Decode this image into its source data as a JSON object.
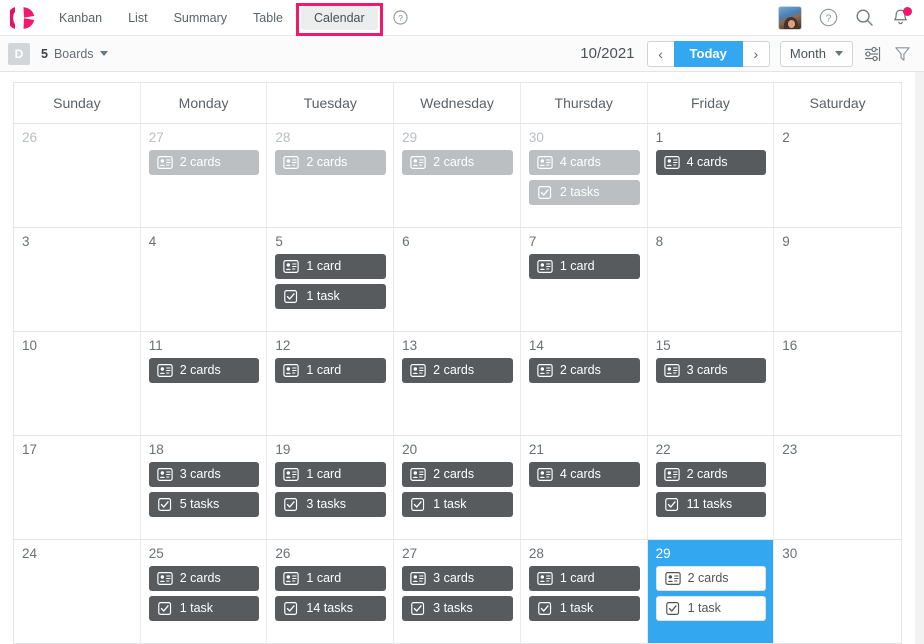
{
  "topnav": {
    "logo_icon": "kanbanize-k-logo",
    "tabs": [
      {
        "label": "Kanban",
        "active": false,
        "name": "tab-kanban"
      },
      {
        "label": "List",
        "active": false,
        "name": "tab-list"
      },
      {
        "label": "Summary",
        "active": false,
        "name": "tab-summary"
      },
      {
        "label": "Table",
        "active": false,
        "name": "tab-table"
      },
      {
        "label": "Calendar",
        "active": true,
        "name": "tab-calendar"
      }
    ],
    "help_icon": "question-circle-icon",
    "avatar_icon": "user-avatar",
    "help_right_icon": "help-circle-icon",
    "search_icon": "search-icon",
    "notification_icon": "bell-icon"
  },
  "toolbar": {
    "board_badge": "D",
    "boards_count": "5",
    "boards_label": "Boards",
    "month_year": "10/2021",
    "prev_label": "‹",
    "today_label": "Today",
    "next_label": "›",
    "view_mode": "Month",
    "settings_icon": "sliders-icon",
    "filter_icon": "filter-funnel-icon"
  },
  "calendar": {
    "accent_blue": "#33a7f0",
    "accent_pink": "#f4176d",
    "badge_dark": "#575b5d",
    "badge_muted": "#bcbfc1",
    "weekdays": [
      "Sunday",
      "Monday",
      "Tuesday",
      "Wednesday",
      "Thursday",
      "Friday",
      "Saturday"
    ],
    "weeks": [
      [
        {
          "day": "26",
          "other": true,
          "today": false,
          "badges": []
        },
        {
          "day": "27",
          "other": true,
          "today": false,
          "badges": [
            {
              "icon": "cards-icon",
              "label": "2 cards"
            }
          ]
        },
        {
          "day": "28",
          "other": true,
          "today": false,
          "badges": [
            {
              "icon": "cards-icon",
              "label": "2 cards"
            }
          ]
        },
        {
          "day": "29",
          "other": true,
          "today": false,
          "badges": [
            {
              "icon": "cards-icon",
              "label": "2 cards"
            }
          ]
        },
        {
          "day": "30",
          "other": true,
          "today": false,
          "badges": [
            {
              "icon": "cards-icon",
              "label": "4 cards"
            },
            {
              "icon": "tasks-icon",
              "label": "2 tasks"
            }
          ]
        },
        {
          "day": "1",
          "other": false,
          "today": false,
          "badges": [
            {
              "icon": "cards-icon",
              "label": "4 cards"
            }
          ]
        },
        {
          "day": "2",
          "other": false,
          "today": false,
          "badges": []
        }
      ],
      [
        {
          "day": "3",
          "other": false,
          "today": false,
          "badges": []
        },
        {
          "day": "4",
          "other": false,
          "today": false,
          "badges": []
        },
        {
          "day": "5",
          "other": false,
          "today": false,
          "badges": [
            {
              "icon": "cards-icon",
              "label": "1 card"
            },
            {
              "icon": "tasks-icon",
              "label": "1 task"
            }
          ]
        },
        {
          "day": "6",
          "other": false,
          "today": false,
          "badges": []
        },
        {
          "day": "7",
          "other": false,
          "today": false,
          "badges": [
            {
              "icon": "cards-icon",
              "label": "1 card"
            }
          ]
        },
        {
          "day": "8",
          "other": false,
          "today": false,
          "badges": []
        },
        {
          "day": "9",
          "other": false,
          "today": false,
          "badges": []
        }
      ],
      [
        {
          "day": "10",
          "other": false,
          "today": false,
          "badges": []
        },
        {
          "day": "11",
          "other": false,
          "today": false,
          "badges": [
            {
              "icon": "cards-icon",
              "label": "2 cards"
            }
          ]
        },
        {
          "day": "12",
          "other": false,
          "today": false,
          "badges": [
            {
              "icon": "cards-icon",
              "label": "1 card"
            }
          ]
        },
        {
          "day": "13",
          "other": false,
          "today": false,
          "badges": [
            {
              "icon": "cards-icon",
              "label": "2 cards"
            }
          ]
        },
        {
          "day": "14",
          "other": false,
          "today": false,
          "badges": [
            {
              "icon": "cards-icon",
              "label": "2 cards"
            }
          ]
        },
        {
          "day": "15",
          "other": false,
          "today": false,
          "badges": [
            {
              "icon": "cards-icon",
              "label": "3 cards"
            }
          ]
        },
        {
          "day": "16",
          "other": false,
          "today": false,
          "badges": []
        }
      ],
      [
        {
          "day": "17",
          "other": false,
          "today": false,
          "badges": []
        },
        {
          "day": "18",
          "other": false,
          "today": false,
          "badges": [
            {
              "icon": "cards-icon",
              "label": "3 cards"
            },
            {
              "icon": "tasks-icon",
              "label": "5 tasks"
            }
          ]
        },
        {
          "day": "19",
          "other": false,
          "today": false,
          "badges": [
            {
              "icon": "cards-icon",
              "label": "1 card"
            },
            {
              "icon": "tasks-icon",
              "label": "3 tasks"
            }
          ]
        },
        {
          "day": "20",
          "other": false,
          "today": false,
          "badges": [
            {
              "icon": "cards-icon",
              "label": "2 cards"
            },
            {
              "icon": "tasks-icon",
              "label": "1 task"
            }
          ]
        },
        {
          "day": "21",
          "other": false,
          "today": false,
          "badges": [
            {
              "icon": "cards-icon",
              "label": "4 cards"
            }
          ]
        },
        {
          "day": "22",
          "other": false,
          "today": false,
          "badges": [
            {
              "icon": "cards-icon",
              "label": "2 cards"
            },
            {
              "icon": "tasks-icon",
              "label": "11 tasks"
            }
          ]
        },
        {
          "day": "23",
          "other": false,
          "today": false,
          "badges": []
        }
      ],
      [
        {
          "day": "24",
          "other": false,
          "today": false,
          "badges": []
        },
        {
          "day": "25",
          "other": false,
          "today": false,
          "badges": [
            {
              "icon": "cards-icon",
              "label": "2 cards"
            },
            {
              "icon": "tasks-icon",
              "label": "1 task"
            }
          ]
        },
        {
          "day": "26",
          "other": false,
          "today": false,
          "badges": [
            {
              "icon": "cards-icon",
              "label": "1 card"
            },
            {
              "icon": "tasks-icon",
              "label": "14 tasks"
            }
          ]
        },
        {
          "day": "27",
          "other": false,
          "today": false,
          "badges": [
            {
              "icon": "cards-icon",
              "label": "3 cards"
            },
            {
              "icon": "tasks-icon",
              "label": "3 tasks"
            }
          ]
        },
        {
          "day": "28",
          "other": false,
          "today": false,
          "badges": [
            {
              "icon": "cards-icon",
              "label": "1 card"
            },
            {
              "icon": "tasks-icon",
              "label": "1 task"
            }
          ]
        },
        {
          "day": "29",
          "other": false,
          "today": true,
          "badges": [
            {
              "icon": "cards-icon",
              "label": "2 cards"
            },
            {
              "icon": "tasks-icon",
              "label": "1 task"
            }
          ]
        },
        {
          "day": "30",
          "other": false,
          "today": false,
          "badges": []
        }
      ]
    ]
  }
}
